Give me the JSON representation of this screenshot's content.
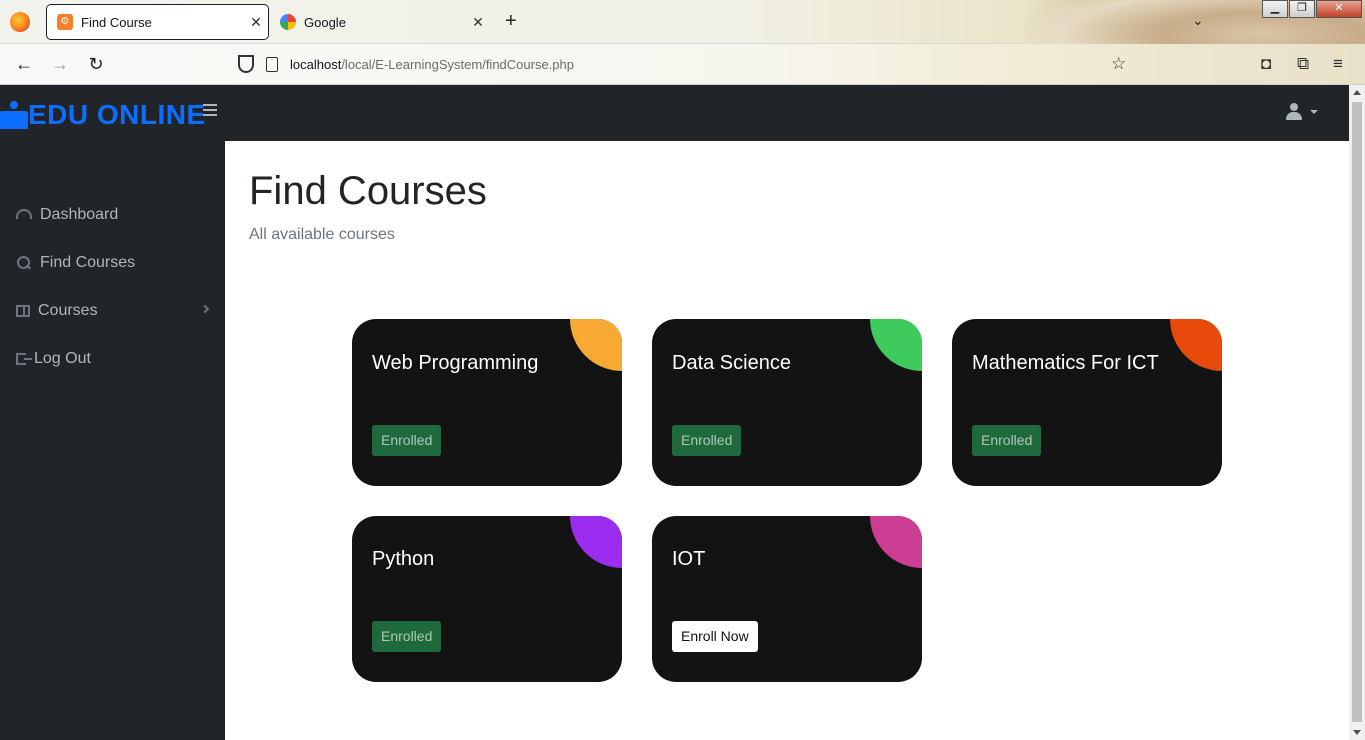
{
  "browser": {
    "tabs": [
      {
        "title": "Find Course",
        "active": true
      },
      {
        "title": "Google",
        "active": false
      }
    ],
    "url_host": "localhost",
    "url_path": "/local/E-LearningSystem/findCourse.php"
  },
  "app": {
    "brand": "EDU ONLINE"
  },
  "sidebar": {
    "items": [
      {
        "label": "Dashboard",
        "icon": "gauge-icon"
      },
      {
        "label": "Find Courses",
        "icon": "search-icon"
      },
      {
        "label": "Courses",
        "icon": "columns-icon"
      },
      {
        "label": "Log Out",
        "icon": "logout-icon"
      }
    ]
  },
  "main": {
    "title": "Find Courses",
    "subtitle": "All available courses",
    "courses": [
      {
        "name": "Web Programming",
        "status": "Enrolled",
        "color": "#f7a934"
      },
      {
        "name": "Data Science",
        "status": "Enrolled",
        "color": "#3ecb5c"
      },
      {
        "name": "Mathematics For ICT",
        "status": "Enrolled",
        "color": "#e84a0c"
      },
      {
        "name": "Python",
        "status": "Enrolled",
        "color": "#9b2cf0"
      },
      {
        "name": "IOT",
        "status": "Enroll Now",
        "color": "#cc3d94"
      }
    ]
  },
  "colors": {
    "brand": "#0d6efd",
    "dark": "#212529",
    "card_bg": "#131313",
    "enrolled_bg": "#1e6a3e"
  }
}
